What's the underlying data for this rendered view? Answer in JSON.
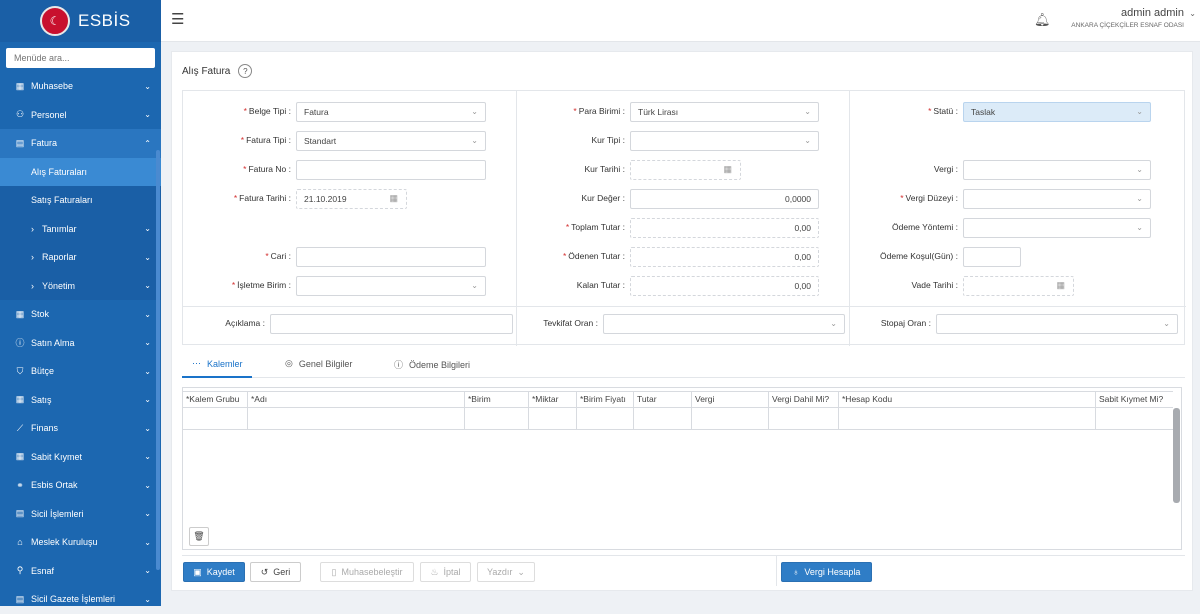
{
  "app": {
    "logo_text": "ESBİS"
  },
  "sidebar": {
    "search_placeholder": "Menüde ara...",
    "items": [
      {
        "label": "Muhasebe",
        "icon": "calculator-icon"
      },
      {
        "label": "Personel",
        "icon": "users-icon"
      },
      {
        "label": "Fatura",
        "icon": "invoice-icon",
        "expanded": true
      },
      {
        "label": "Stok",
        "icon": "grid-icon"
      },
      {
        "label": "Satın Alma",
        "icon": "info-icon"
      },
      {
        "label": "Bütçe",
        "icon": "shield-icon"
      },
      {
        "label": "Satış",
        "icon": "grid-icon"
      },
      {
        "label": "Finans",
        "icon": "chart-icon"
      },
      {
        "label": "Sabit Kıymet",
        "icon": "grid-icon"
      },
      {
        "label": "Esbis Ortak",
        "icon": "link-icon"
      },
      {
        "label": "Sicil İşlemleri",
        "icon": "document-icon"
      },
      {
        "label": "Meslek Kuruluşu",
        "icon": "building-icon"
      },
      {
        "label": "Esnaf",
        "icon": "user-icon"
      },
      {
        "label": "Sicil Gazete İşlemleri",
        "icon": "document-icon"
      }
    ],
    "fatura_sub": [
      {
        "label": "Alış Faturaları",
        "selected": true
      },
      {
        "label": "Satış Faturaları"
      },
      {
        "label": "Tanımlar",
        "nested": true
      },
      {
        "label": "Raporlar",
        "nested": true
      },
      {
        "label": "Yönetim",
        "nested": true
      }
    ]
  },
  "header": {
    "user_name": "admin admin",
    "org": "ANKARA ÇİÇEKÇİLER ESNAF ODASI"
  },
  "page": {
    "title": "Alış Fatura",
    "help": "?"
  },
  "form": {
    "belge_tipi": {
      "label": "Belge Tipi",
      "value": "Fatura"
    },
    "fatura_tipi": {
      "label": "Fatura Tipi",
      "value": "Standart"
    },
    "fatura_no": {
      "label": "Fatura No",
      "value": ""
    },
    "fatura_tarihi": {
      "label": "Fatura Tarihi",
      "value": "21.10.2019"
    },
    "cari": {
      "label": "Cari",
      "value": ""
    },
    "isletme_birim": {
      "label": "İşletme Birim",
      "value": ""
    },
    "aciklama": {
      "label": "Açıklama",
      "value": ""
    },
    "para_birimi": {
      "label": "Para Birimi",
      "value": "Türk Lirası"
    },
    "kur_tipi": {
      "label": "Kur Tipi",
      "value": ""
    },
    "kur_tarihi": {
      "label": "Kur Tarihi",
      "value": ""
    },
    "kur_deger": {
      "label": "Kur Değer",
      "value": "0,0000"
    },
    "toplam_tutar": {
      "label": "Toplam Tutar",
      "value": "0,00"
    },
    "odenen_tutar": {
      "label": "Ödenen Tutar",
      "value": "0,00"
    },
    "kalan_tutar": {
      "label": "Kalan Tutar",
      "value": "0,00"
    },
    "tevkifat_oran": {
      "label": "Tevkifat Oran",
      "value": ""
    },
    "statu": {
      "label": "Statü",
      "value": "Taslak"
    },
    "vergi": {
      "label": "Vergi",
      "value": ""
    },
    "vergi_duzeyi": {
      "label": "Vergi Düzeyi",
      "value": ""
    },
    "odeme_yontemi": {
      "label": "Ödeme Yöntemi",
      "value": ""
    },
    "odeme_kosulu": {
      "label": "Ödeme Koşul(Gün)",
      "value": ""
    },
    "vade_tarihi": {
      "label": "Vade Tarihi",
      "value": ""
    },
    "stopaj_oran": {
      "label": "Stopaj Oran",
      "value": ""
    }
  },
  "tabs": [
    {
      "label": "Kalemler",
      "icon": "dots-icon",
      "active": true
    },
    {
      "label": "Genel Bilgiler",
      "icon": "check-circle-icon"
    },
    {
      "label": "Ödeme Bilgileri",
      "icon": "info-icon"
    }
  ],
  "grid": {
    "columns": [
      "*Kalem Grubu",
      "*Adı",
      "*Birim",
      "*Miktar",
      "*Birim Fiyatı",
      "Tutar",
      "Vergi",
      "Vergi Dahil Mi?",
      "*Hesap Kodu",
      "Sabit Kıymet Mi?"
    ]
  },
  "actions": {
    "save": "Kaydet",
    "back": "Geri",
    "post": "Muhasebeleştir",
    "cancel": "İptal",
    "print": "Yazdır",
    "calc_tax": "Vergi Hesapla"
  },
  "colors": {
    "sidebar": "#1c67b0",
    "primary": "#2f7dc6",
    "required": "#d32f2f"
  }
}
